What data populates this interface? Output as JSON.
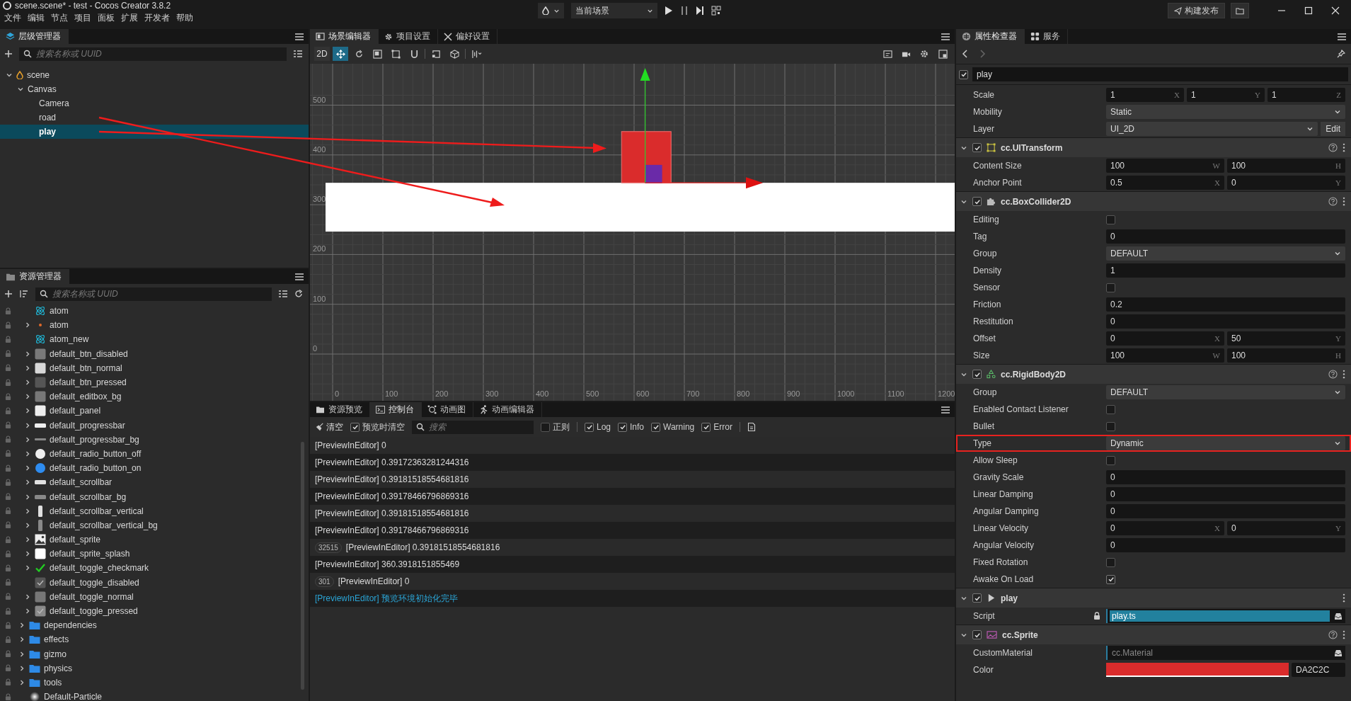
{
  "top_bar": {
    "title": "scene.scene* - test - Cocos Creator 3.8.2",
    "menu": [
      "文件",
      "编辑",
      "节点",
      "项目",
      "面板",
      "扩展",
      "开发者",
      "帮助"
    ],
    "scene_select": "当前场景",
    "build_button": "构建发布"
  },
  "hierarchy": {
    "tab": "层级管理器",
    "search_placeholder": "搜索名称或 UUID",
    "tree": [
      {
        "name": "scene",
        "kind": "scene",
        "expanded": true,
        "selected": false,
        "children": [
          {
            "name": "Canvas",
            "expanded": true,
            "selected": false,
            "children": [
              {
                "name": "Camera",
                "selected": false
              },
              {
                "name": "road",
                "selected": false
              },
              {
                "name": "play",
                "selected": true
              }
            ]
          }
        ]
      }
    ]
  },
  "assets": {
    "tab": "资源管理器",
    "search_placeholder": "搜索名称或 UUID",
    "inner_rows": [
      {
        "name": "atom",
        "kind": "atom",
        "expandable": false
      },
      {
        "name": "atom",
        "kind": "particle",
        "expandable": true
      },
      {
        "name": "atom_new",
        "kind": "atom",
        "expandable": false
      },
      {
        "name": "default_btn_disabled",
        "kind": "square",
        "color": "#7a7a7a",
        "expandable": true
      },
      {
        "name": "default_btn_normal",
        "kind": "square",
        "color": "#d8d8d8",
        "expandable": true
      },
      {
        "name": "default_btn_pressed",
        "kind": "square",
        "color": "#555555",
        "expandable": true
      },
      {
        "name": "default_editbox_bg",
        "kind": "square",
        "color": "#777777",
        "expandable": true
      },
      {
        "name": "default_panel",
        "kind": "square",
        "color": "#eeeeee",
        "expandable": true
      },
      {
        "name": "default_progressbar",
        "kind": "bar",
        "color": "#eeeeee",
        "expandable": true
      },
      {
        "name": "default_progressbar_bg",
        "kind": "thin_bar",
        "color": "#888888",
        "expandable": true
      },
      {
        "name": "default_radio_button_off",
        "kind": "circle",
        "color": "#eeeeee",
        "expandable": true
      },
      {
        "name": "default_radio_button_on",
        "kind": "circle",
        "color": "#2e8cf0",
        "expandable": true
      },
      {
        "name": "default_scrollbar",
        "kind": "bar",
        "color": "#e0e0e0",
        "expandable": true
      },
      {
        "name": "default_scrollbar_bg",
        "kind": "bar",
        "color": "#888888",
        "expandable": true
      },
      {
        "name": "default_scrollbar_vertical",
        "kind": "tall_bar",
        "color": "#e0e0e0",
        "expandable": true
      },
      {
        "name": "default_scrollbar_vertical_bg",
        "kind": "tall_bar",
        "color": "#888888",
        "expandable": true
      },
      {
        "name": "default_sprite",
        "kind": "image",
        "color": "#eeeeee",
        "expandable": true
      },
      {
        "name": "default_sprite_splash",
        "kind": "square",
        "color": "#ffffff",
        "expandable": true
      },
      {
        "name": "default_toggle_checkmark",
        "kind": "check",
        "color": "#22cc22",
        "expandable": true
      },
      {
        "name": "default_toggle_disabled",
        "kind": "toggle",
        "color": "#555555",
        "expandable": false
      },
      {
        "name": "default_toggle_normal",
        "kind": "square",
        "color": "#777777",
        "expandable": true
      },
      {
        "name": "default_toggle_pressed",
        "kind": "toggle",
        "color": "#8a8a8a",
        "expandable": true
      }
    ],
    "rows": [
      {
        "name": "dependencies",
        "kind": "folder",
        "expandable": true
      },
      {
        "name": "effects",
        "kind": "folder",
        "expandable": true
      },
      {
        "name": "gizmo",
        "kind": "folder",
        "expandable": true
      },
      {
        "name": "physics",
        "kind": "folder",
        "expandable": true
      },
      {
        "name": "tools",
        "kind": "folder",
        "expandable": true
      },
      {
        "name": "Default-Particle",
        "kind": "glow",
        "expandable": false
      }
    ]
  },
  "scene_editor": {
    "tabs": [
      {
        "label": "场景编辑器",
        "selected": true
      },
      {
        "label": "项目设置",
        "selected": false
      },
      {
        "label": "偏好设置",
        "selected": false
      }
    ],
    "mode_button": "2D",
    "y_labels": [
      "500",
      "400",
      "300",
      "200",
      "100",
      "0"
    ],
    "x_labels": [
      "0",
      "100",
      "200",
      "300",
      "400",
      "500",
      "600",
      "700",
      "800",
      "900",
      "1000",
      "1100",
      "1200"
    ]
  },
  "console": {
    "tabs": [
      {
        "label": "资源预览",
        "selected": false
      },
      {
        "label": "控制台",
        "selected": true
      },
      {
        "label": "动画图",
        "selected": false
      },
      {
        "label": "动画编辑器",
        "selected": false
      }
    ],
    "clear_button": "清空",
    "filters": [
      {
        "label": "预览时清空",
        "checked": true
      }
    ],
    "search_placeholder": "搜索",
    "levels": [
      {
        "label": "正则",
        "checked": false
      },
      {
        "label": "Log",
        "checked": true
      },
      {
        "label": "Info",
        "checked": true
      },
      {
        "label": "Warning",
        "checked": true
      },
      {
        "label": "Error",
        "checked": true
      }
    ],
    "lines": [
      {
        "kind": "log",
        "text": "[PreviewInEditor] 0"
      },
      {
        "kind": "log",
        "text": "[PreviewInEditor] 0.39172363281244316"
      },
      {
        "kind": "log",
        "text": "[PreviewInEditor] 0.39181518554681816"
      },
      {
        "kind": "log",
        "text": "[PreviewInEditor] 0.39178466796869316"
      },
      {
        "kind": "log",
        "text": "[PreviewInEditor] 0.39181518554681816"
      },
      {
        "kind": "log",
        "text": "[PreviewInEditor] 0.39178466796869316"
      },
      {
        "kind": "log",
        "count": "32515",
        "text": "[PreviewInEditor] 0.39181518554681816"
      },
      {
        "kind": "log",
        "text": "[PreviewInEditor] 360.3918151855469"
      },
      {
        "kind": "log",
        "count": "301",
        "text": "[PreviewInEditor] 0"
      },
      {
        "kind": "info",
        "text": "[PreviewInEditor] 预览环境初始化完毕"
      }
    ]
  },
  "inspector": {
    "tabs": [
      {
        "label": "属性检查器",
        "selected": true
      },
      {
        "label": "服务",
        "selected": false
      }
    ],
    "node": {
      "enabled": true,
      "name": "play",
      "props": [
        {
          "label": "Scale",
          "kind": "vector",
          "highlighted": false,
          "values": [
            {
              "value": "1",
              "axis": "X"
            },
            {
              "value": "1",
              "axis": "Y"
            },
            {
              "value": "1",
              "axis": "Z"
            }
          ]
        },
        {
          "label": "Mobility",
          "kind": "select",
          "highlighted": false,
          "value": "Static"
        },
        {
          "label": "Layer",
          "kind": "select",
          "highlighted": false,
          "value": "UI_2D",
          "button": "Edit"
        }
      ]
    },
    "components": [
      {
        "title": "cc.UITransform",
        "kind": "transform",
        "enabled": true,
        "expanded": true,
        "help": true,
        "props": [
          {
            "label": "Content Size",
            "kind": "vector",
            "highlighted": false,
            "values": [
              {
                "value": "100",
                "axis": "W"
              },
              {
                "value": "100",
                "axis": "H"
              }
            ]
          },
          {
            "label": "Anchor Point",
            "kind": "vector",
            "highlighted": false,
            "values": [
              {
                "value": "0.5",
                "axis": "X"
              },
              {
                "value": "0",
                "axis": "Y"
              }
            ]
          }
        ]
      },
      {
        "title": "cc.BoxCollider2D",
        "kind": "collider",
        "enabled": true,
        "expanded": true,
        "help": true,
        "props": [
          {
            "label": "Editing",
            "kind": "checkbox",
            "highlighted": false,
            "checked": false
          },
          {
            "label": "Tag",
            "kind": "number",
            "highlighted": false,
            "value": "0"
          },
          {
            "label": "Group",
            "kind": "select",
            "highlighted": false,
            "value": "DEFAULT"
          },
          {
            "label": "Density",
            "kind": "number",
            "highlighted": false,
            "value": "1"
          },
          {
            "label": "Sensor",
            "kind": "checkbox",
            "highlighted": false,
            "checked": false
          },
          {
            "label": "Friction",
            "kind": "number",
            "highlighted": false,
            "value": "0.2"
          },
          {
            "label": "Restitution",
            "kind": "number",
            "highlighted": false,
            "value": "0"
          },
          {
            "label": "Offset",
            "kind": "vector",
            "highlighted": false,
            "values": [
              {
                "value": "0",
                "axis": "X"
              },
              {
                "value": "50",
                "axis": "Y"
              }
            ]
          },
          {
            "label": "Size",
            "kind": "vector",
            "highlighted": false,
            "values": [
              {
                "value": "100",
                "axis": "W"
              },
              {
                "value": "100",
                "axis": "H"
              }
            ]
          }
        ]
      },
      {
        "title": "cc.RigidBody2D",
        "kind": "rigidbody",
        "enabled": true,
        "expanded": true,
        "help": true,
        "props": [
          {
            "label": "Group",
            "kind": "select",
            "highlighted": false,
            "value": "DEFAULT"
          },
          {
            "label": "Enabled Contact Listener",
            "kind": "checkbox",
            "highlighted": false,
            "checked": false
          },
          {
            "label": "Bullet",
            "kind": "checkbox",
            "highlighted": false,
            "checked": false
          },
          {
            "label": "Type",
            "kind": "select",
            "highlighted": true,
            "value": "Dynamic"
          },
          {
            "label": "Allow Sleep",
            "kind": "checkbox",
            "highlighted": false,
            "checked": false
          },
          {
            "label": "Gravity Scale",
            "kind": "number",
            "highlighted": false,
            "value": "0"
          },
          {
            "label": "Linear Damping",
            "kind": "number",
            "highlighted": false,
            "value": "0"
          },
          {
            "label": "Angular Damping",
            "kind": "number",
            "highlighted": false,
            "value": "0"
          },
          {
            "label": "Linear Velocity",
            "kind": "vector",
            "highlighted": false,
            "values": [
              {
                "value": "0",
                "axis": "X"
              },
              {
                "value": "0",
                "axis": "Y"
              }
            ]
          },
          {
            "label": "Angular Velocity",
            "kind": "number",
            "highlighted": false,
            "value": "0"
          },
          {
            "label": "Fixed Rotation",
            "kind": "checkbox",
            "highlighted": false,
            "checked": false
          },
          {
            "label": "Awake On Load",
            "kind": "checkbox",
            "highlighted": false,
            "checked": true
          }
        ]
      },
      {
        "title": "play",
        "kind": "script",
        "enabled": true,
        "expanded": true,
        "help": false,
        "props": [
          {
            "label": "Script",
            "kind": "asset",
            "highlighted": false,
            "locked": true,
            "value": "play.ts"
          }
        ]
      },
      {
        "title": "cc.Sprite",
        "kind": "sprite",
        "enabled": true,
        "expanded": true,
        "help": true,
        "props": [
          {
            "label": "CustomMaterial",
            "kind": "asset",
            "highlighted": false,
            "locked": false,
            "placeholder": "cc.Material"
          },
          {
            "label": "Color",
            "kind": "color",
            "highlighted": false,
            "color": "#da2c2c",
            "value": "DA2C2C"
          }
        ]
      }
    ]
  }
}
